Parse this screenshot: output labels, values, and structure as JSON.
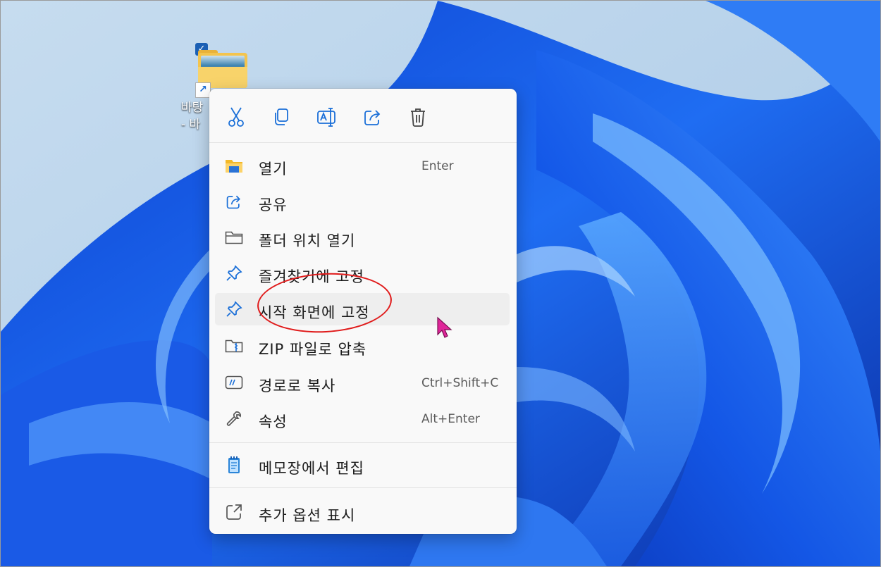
{
  "desktop": {
    "icon_label": "바탕\n- 바",
    "icons": {
      "checkbox": "checkbox-icon",
      "folder": "folder-icon",
      "shortcut": "shortcut-arrow-icon"
    }
  },
  "menu": {
    "toolbar": [
      {
        "name": "cut-icon"
      },
      {
        "name": "copy-icon"
      },
      {
        "name": "rename-icon"
      },
      {
        "name": "share-icon"
      },
      {
        "name": "delete-icon"
      }
    ],
    "items": [
      {
        "label": "열기",
        "shortcut": "Enter",
        "icon": "open-folder-icon"
      },
      {
        "label": "공유",
        "shortcut": "",
        "icon": "share-icon"
      },
      {
        "label": "폴더 위치 열기",
        "shortcut": "",
        "icon": "folder-outline-icon"
      },
      {
        "label": "즐겨찾기에 고정",
        "shortcut": "",
        "icon": "pin-icon"
      },
      {
        "label": "시작 화면에 고정",
        "shortcut": "",
        "icon": "pin-icon"
      },
      {
        "label": "ZIP 파일로 압축",
        "shortcut": "",
        "icon": "zip-folder-icon"
      },
      {
        "label": "경로로 복사",
        "shortcut": "Ctrl+Shift+C",
        "icon": "copy-path-icon"
      },
      {
        "label": "속성",
        "shortcut": "Alt+Enter",
        "icon": "wrench-icon"
      },
      {
        "label": "메모장에서 편집",
        "shortcut": "",
        "icon": "notepad-icon"
      },
      {
        "label": "추가 옵션 표시",
        "shortcut": "",
        "icon": "more-options-icon"
      }
    ],
    "hovered_item": "시작 화면에 고정"
  },
  "colors": {
    "accent": "#1a6fd8",
    "annotation": "#e01a1a",
    "cursor": "#e0269a"
  }
}
